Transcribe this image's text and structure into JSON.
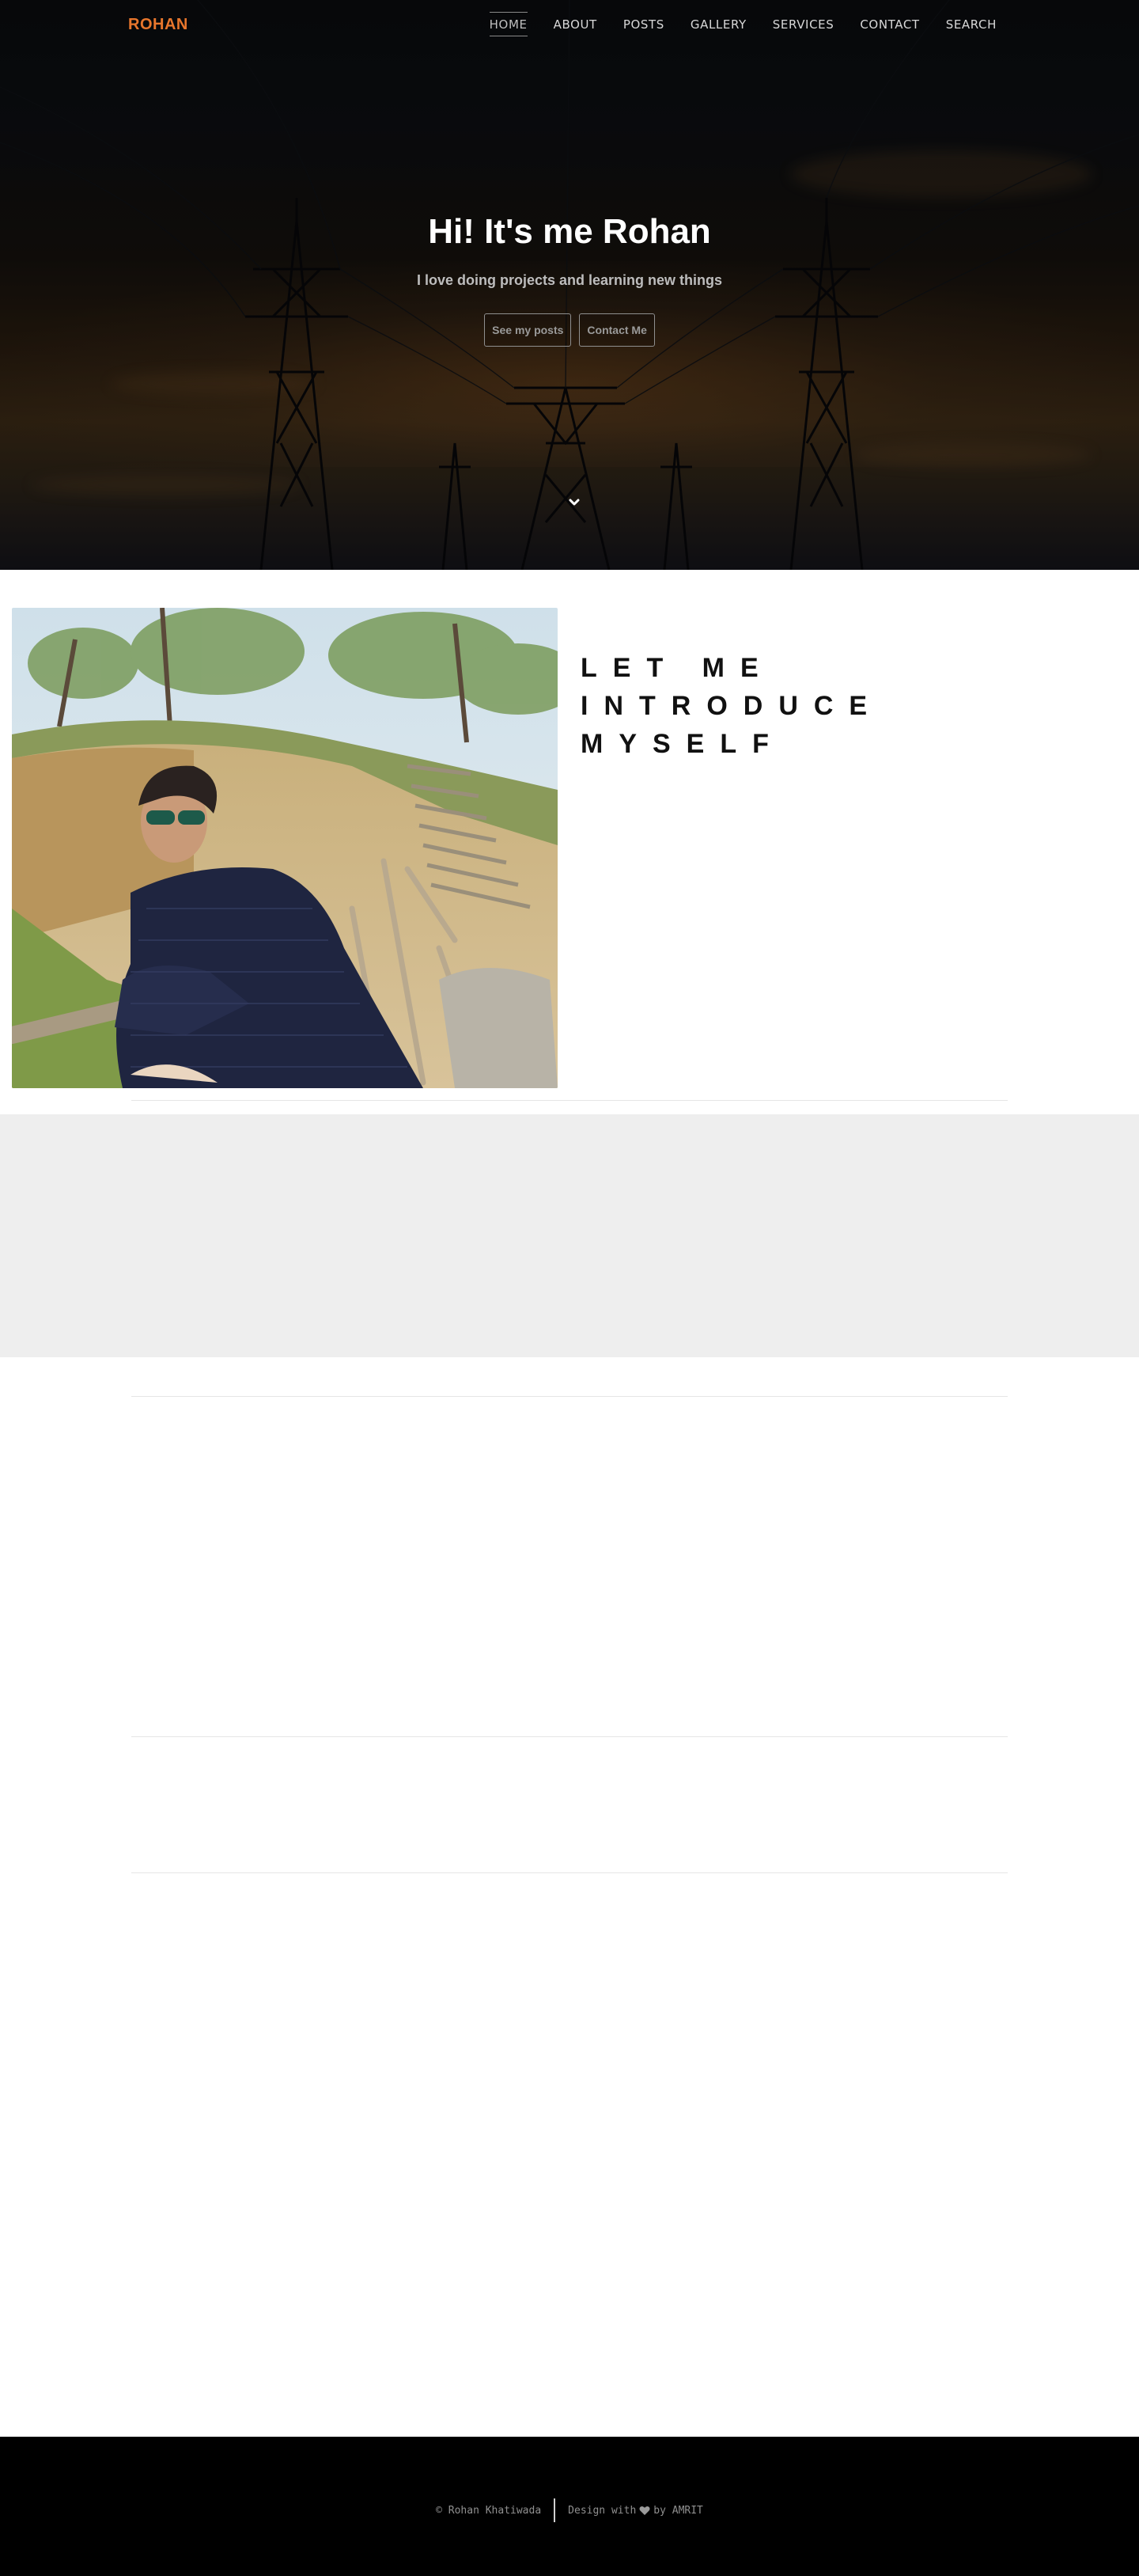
{
  "brand": {
    "logo": "ROHAN",
    "accent": "#e8762c"
  },
  "nav": {
    "items": [
      {
        "label": "HOME",
        "active": true
      },
      {
        "label": "ABOUT"
      },
      {
        "label": "POSTS"
      },
      {
        "label": "GALLERY"
      },
      {
        "label": "SERVICES"
      },
      {
        "label": "CONTACT"
      },
      {
        "label": "SEARCH"
      }
    ]
  },
  "hero": {
    "title": "Hi! It's me Rohan",
    "subtitle": "I love doing projects and learning new things",
    "buttons": {
      "posts": "See my posts",
      "contact": "Contact Me"
    },
    "scroll_icon": "chevron-down-icon"
  },
  "about": {
    "title": "LET ME INTRODUCE MYSELF",
    "photo_icon": "profile-photo"
  },
  "footer": {
    "copyright": "© Rohan Khatiwada",
    "design_prefix": "Design with",
    "design_suffix": "by AMRIT",
    "heart_icon": "heart-icon"
  }
}
